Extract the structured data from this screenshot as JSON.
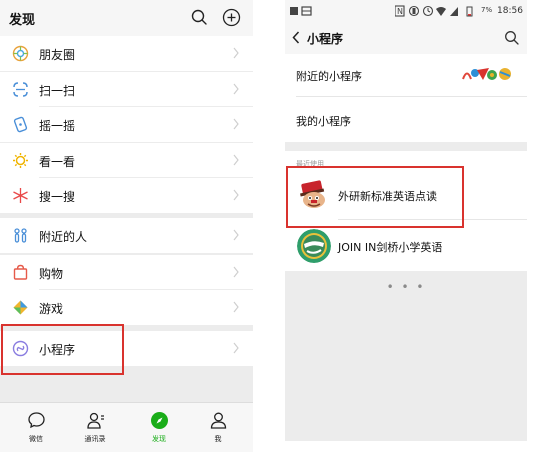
{
  "left": {
    "header": {
      "title": "发现"
    },
    "menu": [
      {
        "label": "朋友圈",
        "icon": "moments-icon"
      },
      {
        "label": "扫一扫",
        "icon": "scan-icon"
      },
      {
        "label": "摇一摇",
        "icon": "shake-icon"
      },
      {
        "label": "看一看",
        "icon": "top-stories-icon"
      },
      {
        "label": "搜一搜",
        "icon": "search-star-icon"
      },
      {
        "label": "附近的人",
        "icon": "people-nearby-icon"
      },
      {
        "label": "购物",
        "icon": "shopping-bag-icon"
      },
      {
        "label": "游戏",
        "icon": "games-icon"
      },
      {
        "label": "小程序",
        "icon": "mini-program-icon"
      }
    ],
    "tabbar": [
      {
        "label": "微信",
        "icon": "chats-icon"
      },
      {
        "label": "通讯录",
        "icon": "contacts-icon"
      },
      {
        "label": "发现",
        "icon": "discover-icon",
        "active": true
      },
      {
        "label": "我",
        "icon": "me-icon"
      }
    ]
  },
  "right": {
    "status": {
      "battery": "7%",
      "time": "18:56"
    },
    "header": {
      "title": "小程序"
    },
    "nearby_label": "附近的小程序",
    "my_label": "我的小程序",
    "recent_label": "最近使用",
    "recent_apps": [
      {
        "name": "外研新标准英语点读",
        "icon": "waiyan-app-icon"
      },
      {
        "name": "JOIN IN剑桥小学英语",
        "icon": "join-in-app-icon"
      }
    ],
    "more": "• • •"
  },
  "colors": {
    "accent_green": "#1aad19",
    "highlight_red": "#d9332e",
    "background_gray": "#ececec"
  }
}
